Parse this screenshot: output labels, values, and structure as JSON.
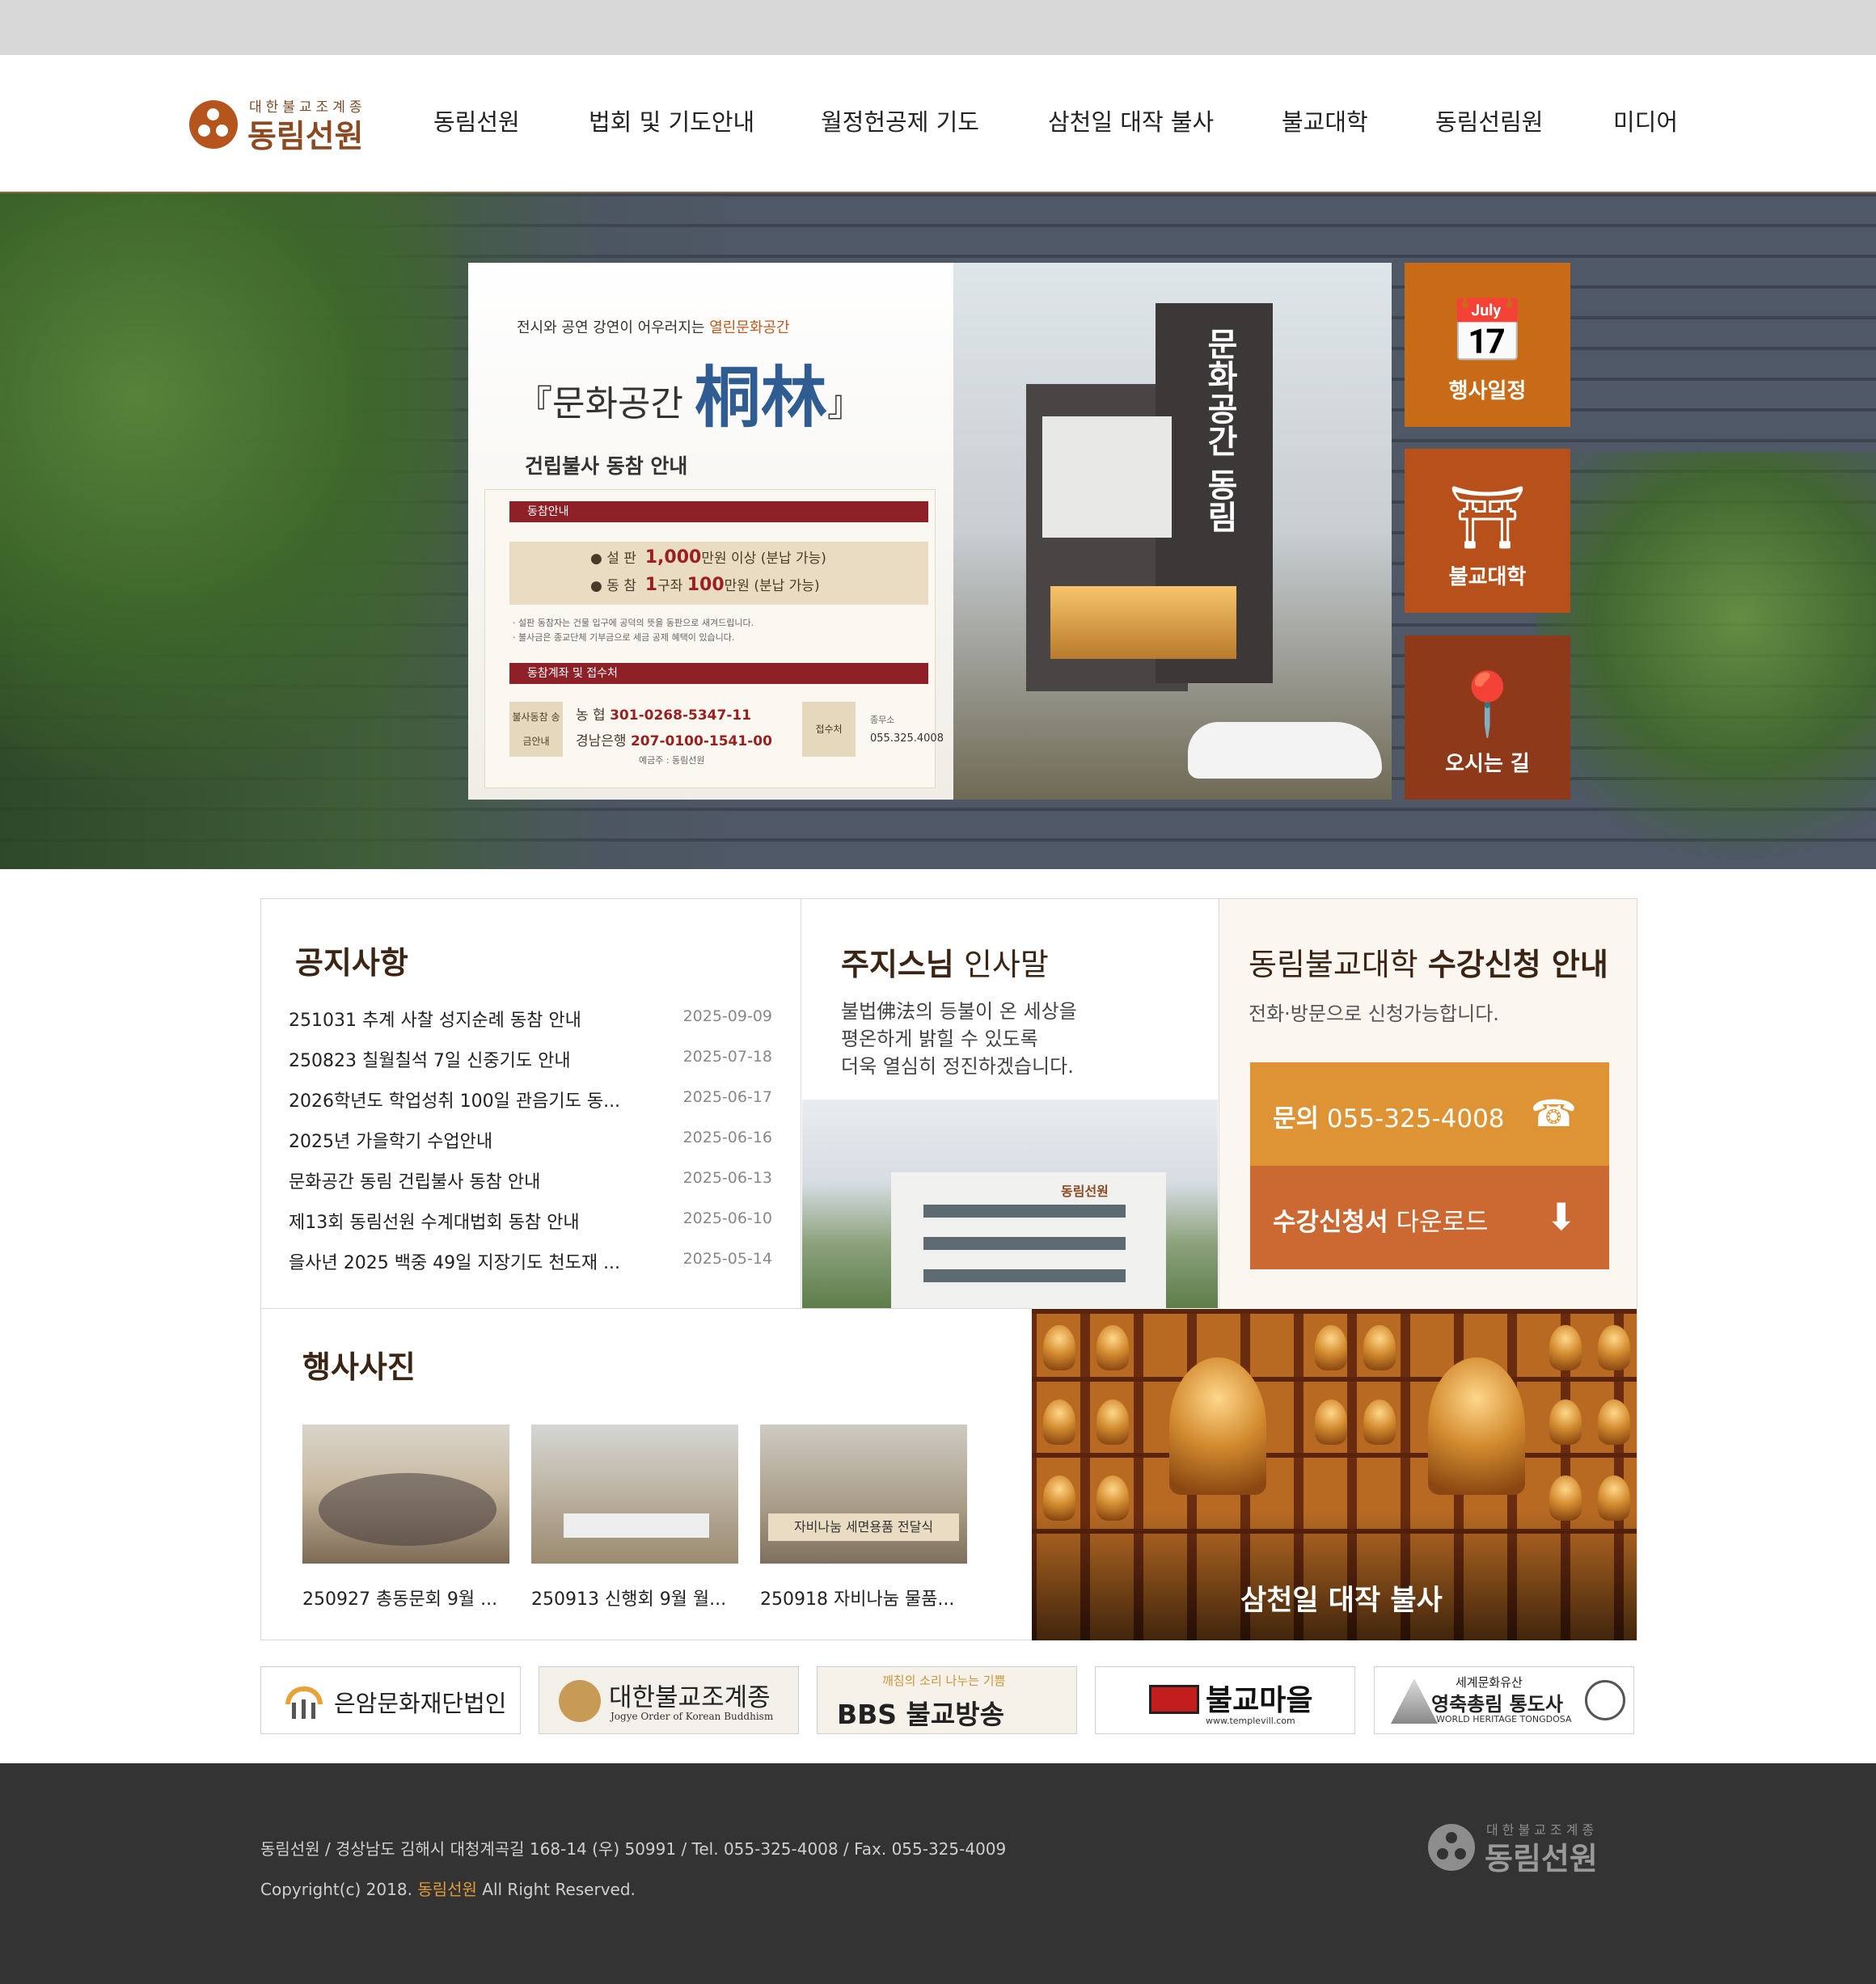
{
  "header": {
    "logo_sub": "대한불교조계종",
    "logo_main": "동림선원",
    "nav": [
      "동림선원",
      "법회 및 기도안내",
      "월정헌공제 기도",
      "삼천일 대작 불사",
      "불교대학",
      "동림선림원",
      "미디어"
    ]
  },
  "hero": {
    "lead_prefix": "전시와 공연 강연이 어우러지는",
    "lead_highlight": "열린문화공간",
    "title_open": "『문화공간",
    "title_big": "桐林",
    "title_close": "』",
    "subtitle": "건립불사 동참 안내",
    "section1": "동참안내",
    "row1_label": "● 설 판",
    "row1_value": "1,000",
    "row1_suffix": "만원 이상 (분납 가능)",
    "row2_label": "● 동 참",
    "row2_value": "1",
    "row2_mid": "구좌",
    "row2_value2": "100",
    "row2_suffix": "만원 (분납 가능)",
    "note1": "· 설판 동참자는 건물 입구에 공덕의 뜻을 동판으로 새겨드립니다.",
    "note2": "· 불사금은 종교단체 기부금으로 세금 공제 혜택이 있습니다.",
    "section2": "동참계좌 및 접수처",
    "tag1": "불사동참 송금안내",
    "acct1_bank": "농 협",
    "acct1_no": "301-0268-5347-11",
    "acct2_bank": "경남은행",
    "acct2_no": "207-0100-1541-00",
    "holder": "예금주 : 동림선원",
    "tag2": "접수처",
    "office_label": "종무소",
    "office_phone": "055.325.4008",
    "building_sign": "문화공간 동림"
  },
  "quick": [
    {
      "label": "행사일정",
      "icon": "calendar-clock-icon",
      "color": "#c96a16"
    },
    {
      "label": "불교대학",
      "icon": "temple-gate-icon",
      "color": "#b8501c"
    },
    {
      "label": "오시는 길",
      "icon": "map-pin-icon",
      "color": "#8e3a1a"
    }
  ],
  "notices": {
    "title": "공지사항",
    "items": [
      {
        "title": "251031 추계 사찰 성지순례 동참 안내",
        "date": "2025-09-09"
      },
      {
        "title": "250823 칠월칠석 7일 신중기도 안내",
        "date": "2025-07-18"
      },
      {
        "title": "2026학년도 학업성취 100일 관음기도 동...",
        "date": "2025-06-17"
      },
      {
        "title": "2025년 가을학기 수업안내",
        "date": "2025-06-16"
      },
      {
        "title": "문화공간 동림 건립불사 동참 안내",
        "date": "2025-06-13"
      },
      {
        "title": "제13회 동림선원 수계대법회 동참 안내",
        "date": "2025-06-10"
      },
      {
        "title": "을사년 2025 백중 49일 지장기도 천도재 ...",
        "date": "2025-05-14"
      }
    ]
  },
  "greeting": {
    "title_bold": "주지스님",
    "title_rest": "인사말",
    "line1": "불법佛法의 등불이 온 세상을",
    "line2": "평온하게 밝힐 수 있도록",
    "line3": "더욱 열심히 정진하겠습니다.",
    "photo_sign": "동림선원"
  },
  "apply": {
    "title_rest": "동림불교대학",
    "title_bold": "수강신청 안내",
    "desc": "전화·방문으로 신청가능합니다.",
    "phone_bold": "문의",
    "phone_number": "055-325-4008",
    "download_bold": "수강신청서",
    "download_rest": "다운로드",
    "phone_color": "#de9335",
    "download_color": "#cc6832"
  },
  "events": {
    "title": "행사사진",
    "photos": [
      {
        "caption": "250927 총동문회 9월 ..."
      },
      {
        "caption": "250913 신행회 9월 월..."
      },
      {
        "caption": "250918 자비나눔 물품..."
      }
    ],
    "photo3_banner": "자비나눔 세면용품 전달식"
  },
  "buddha": {
    "caption": "삼천일 대작 불사"
  },
  "partners": [
    {
      "label": "은암문화재단법인"
    },
    {
      "label": "대한불교조계종",
      "sub": "Jogye Order of Korean Buddhism"
    },
    {
      "label": "BBS 불교방송",
      "sub": "깨침의 소리 나누는 기쁨"
    },
    {
      "label": "불교마을",
      "sub": "www.templevill.com"
    },
    {
      "label": "영축총림 통도사",
      "sub": "세계문화유산",
      "sub2": "WORLD HERITAGE TONGDOSA"
    }
  ],
  "footer": {
    "address": "동림선원 / 경상남도 김해시 대청계곡길 168-14 (우) 50991 / Tel. 055-325-4008 / Fax. 055-325-4009",
    "copy_prefix": "Copyright(c) 2018.",
    "copy_name": "동림선원",
    "copy_suffix": "All Right Reserved.",
    "logo_sub": "대한불교조계종",
    "logo_main": "동림선원"
  }
}
